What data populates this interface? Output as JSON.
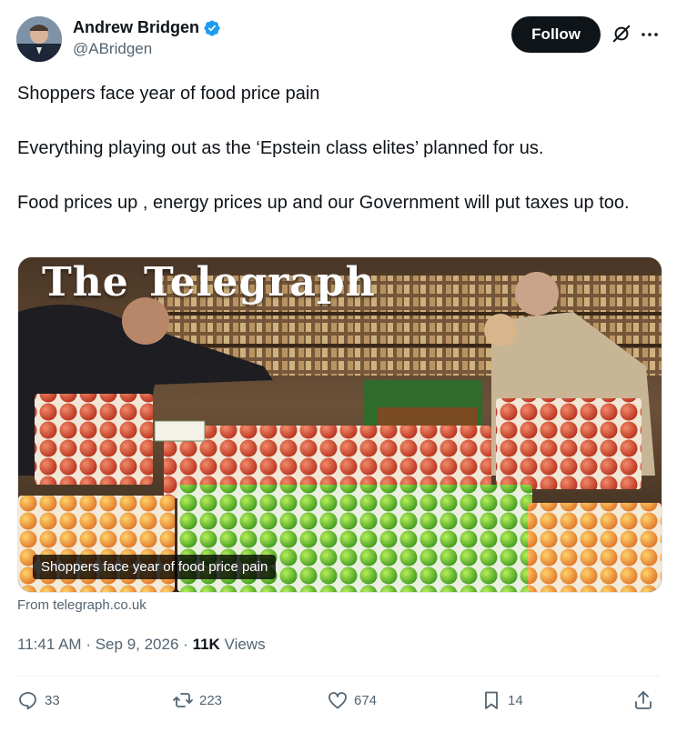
{
  "author": {
    "display_name": "Andrew Bridgen",
    "handle": "@ABridgen",
    "verified_icon": "verified-badge-icon"
  },
  "header": {
    "follow_label": "Follow",
    "grok_icon": "grok-icon",
    "more_icon": "more-icon"
  },
  "tweet": {
    "paragraphs": [
      "Shoppers face year of food price pain",
      "Everything playing out as the ‘Epstein class elites’ planned for us.",
      "Food prices up , energy prices up and our Government will put taxes up too."
    ]
  },
  "media": {
    "masthead": "The Telegraph",
    "caption": "Shoppers face year of food price pain",
    "source": "From telegraph.co.uk"
  },
  "meta": {
    "time": "11:41 AM",
    "separator": "·",
    "date": "Sep 9, 2026",
    "views_count": "11K",
    "views_label": "Views"
  },
  "actions": {
    "replies": "33",
    "reposts": "223",
    "likes": "674",
    "bookmarks": "14"
  },
  "colors": {
    "text_primary": "#0f1419",
    "text_secondary": "#536471",
    "verified_blue": "#1d9bf0",
    "follow_bg": "#0f1419"
  }
}
